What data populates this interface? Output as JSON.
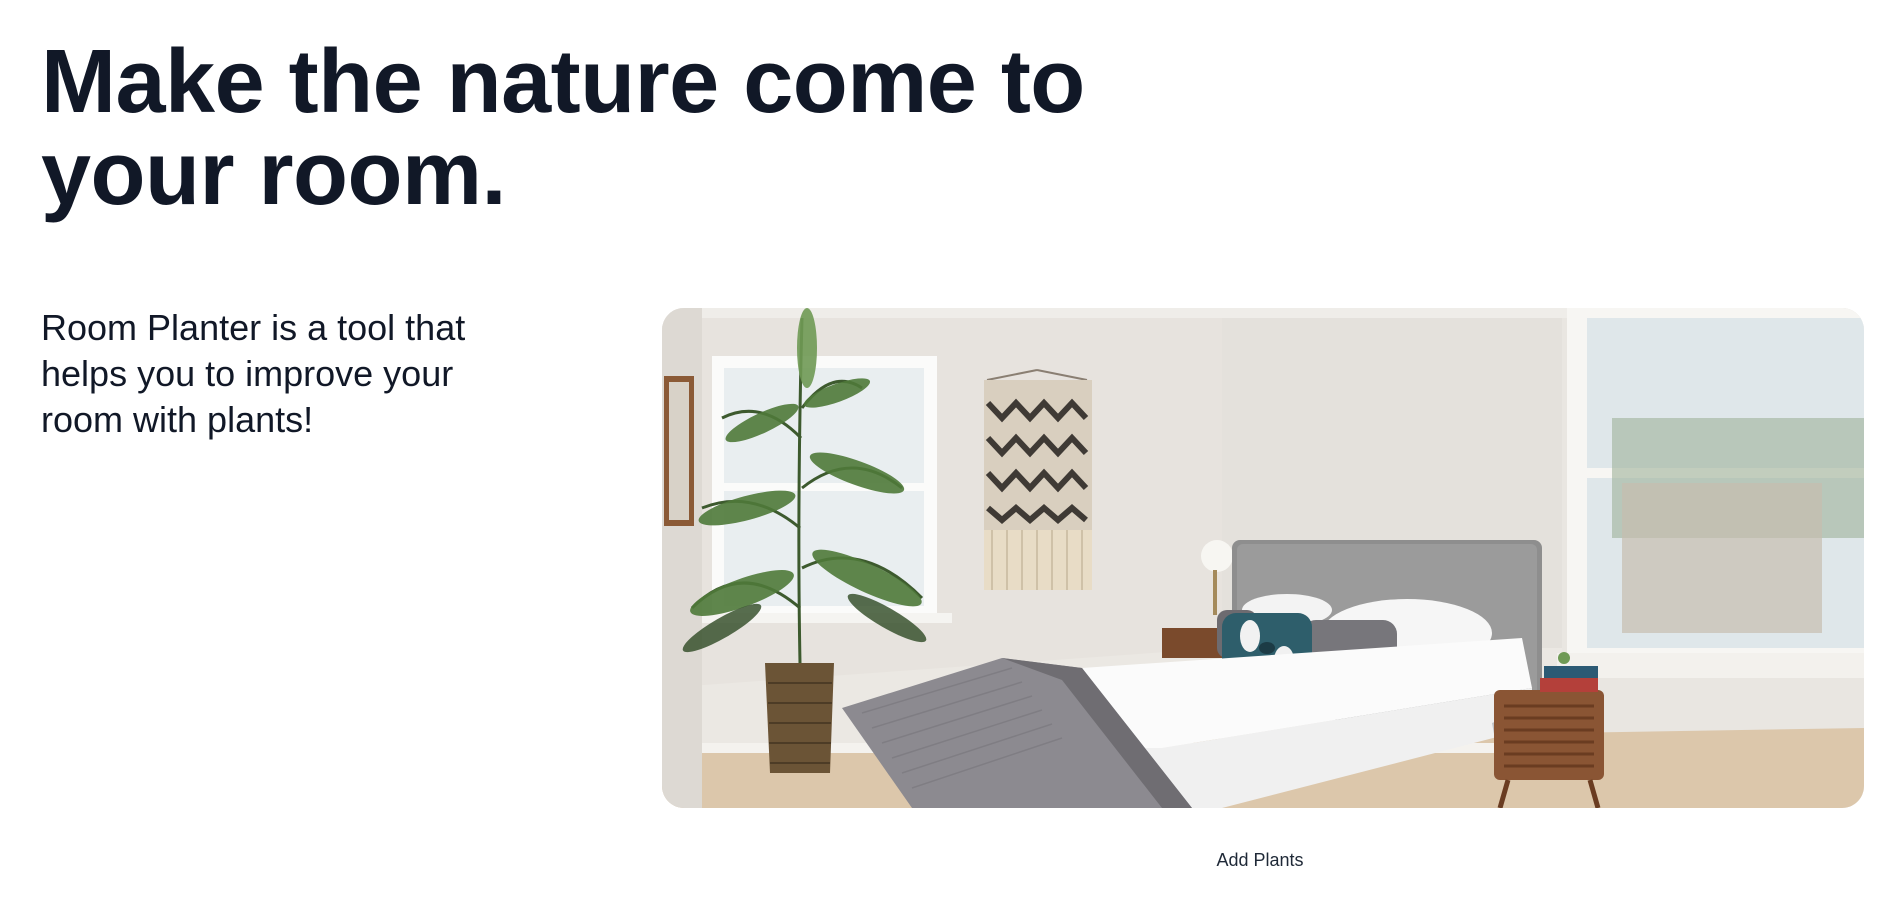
{
  "hero": {
    "headline": "Make the nature come to your room.",
    "tagline": "Room Planter is a tool that helps you to improve your room with plants!"
  },
  "image": {
    "subject": "bedroom-with-plant-photo"
  },
  "actions": {
    "add_plants_label": "Add Plants"
  },
  "colors": {
    "text_primary": "#111827",
    "background": "#ffffff"
  }
}
